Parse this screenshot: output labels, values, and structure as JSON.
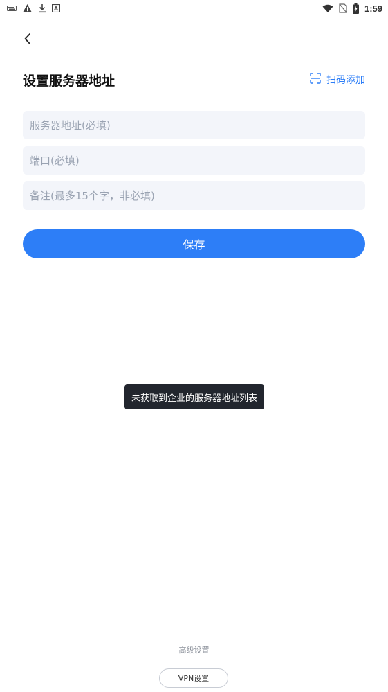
{
  "status_bar": {
    "time": "1:59",
    "left_icons": [
      "keyboard-icon",
      "warning-icon",
      "download-icon",
      "a-box-icon"
    ],
    "right_icons": [
      "wifi-icon",
      "no-sim-icon",
      "battery-charging-icon"
    ]
  },
  "header": {
    "title": "设置服务器地址",
    "scan_add_label": "扫码添加"
  },
  "form": {
    "address_placeholder": "服务器地址(必填)",
    "port_placeholder": "端口(必填)",
    "note_placeholder": "备注(最多15个字，非必填)",
    "address_value": "",
    "port_value": "",
    "note_value": ""
  },
  "actions": {
    "save_label": "保存"
  },
  "toast": {
    "message": "未获取到企业的服务器地址列表"
  },
  "footer": {
    "advanced_label": "高级设置",
    "vpn_label": "VPN设置"
  },
  "colors": {
    "accent": "#2d7ef7",
    "input_bg": "#f3f5fa",
    "toast_bg": "#22262e",
    "placeholder": "#9aa3b2"
  }
}
